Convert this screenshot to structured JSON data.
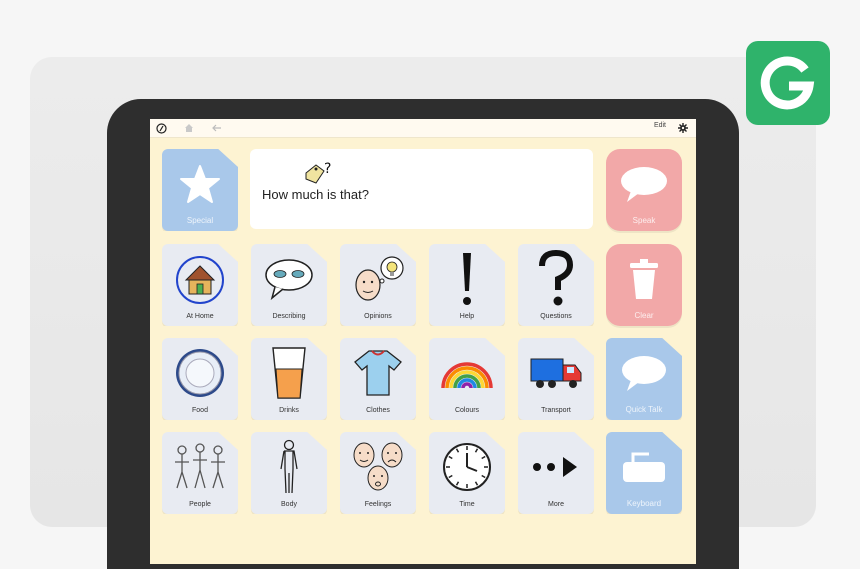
{
  "colors": {
    "badge": "#2fb36b",
    "screen_bg": "#fdf3d2",
    "blue_tile": "#a9c8ea",
    "red_tile": "#f2a8a8",
    "grey_tile": "#e8ebf2"
  },
  "badge": {
    "letter": "G"
  },
  "topbar": {
    "logo_icon": "grid-logo-icon",
    "home_icon": "home-icon",
    "back_icon": "back-arrow-icon",
    "edit_label": "Edit",
    "settings_icon": "gear-icon"
  },
  "message": {
    "text": "How much is that?",
    "symbol_icon": "price-tag-question-icon"
  },
  "tiles": {
    "special": "Special",
    "speak": "Speak",
    "at_home": "At Home",
    "describing": "Describing",
    "opinions": "Opinions",
    "help": "Help",
    "questions": "Questions",
    "clear": "Clear",
    "food": "Food",
    "drinks": "Drinks",
    "clothes": "Clothes",
    "colours": "Colours",
    "transport": "Transport",
    "quick_talk": "Quick Talk",
    "people": "People",
    "body": "Body",
    "feelings": "Feelings",
    "time": "Time",
    "more": "More",
    "keyboard": "Keyboard"
  }
}
